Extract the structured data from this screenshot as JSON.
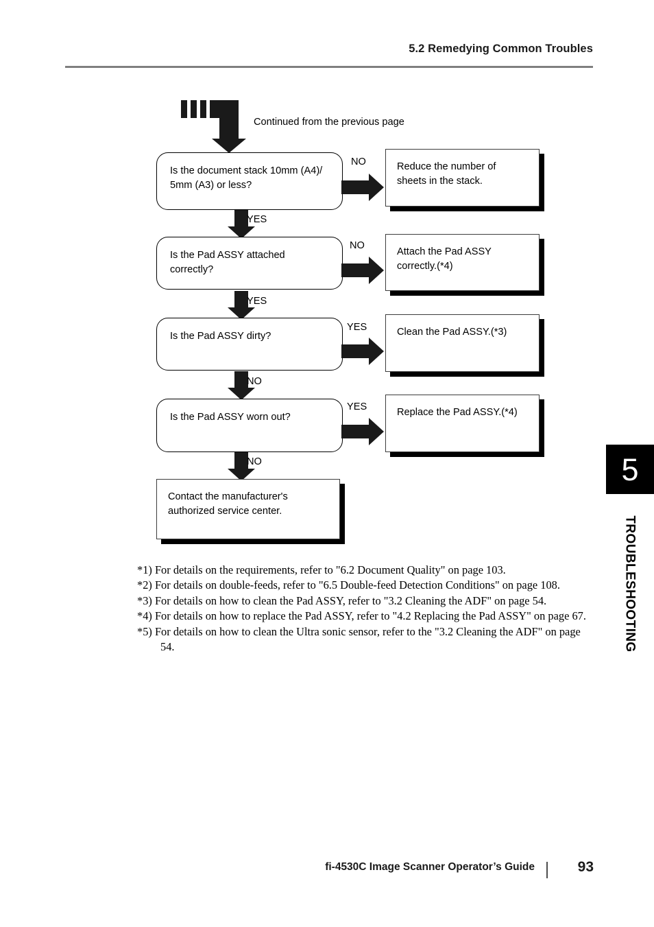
{
  "header": {
    "title": "5.2 Remedying Common Troubles"
  },
  "flowchart": {
    "continued_label": "Continued from the previous page",
    "entry_arrow_icon": "continued-arrow-icon",
    "steps": [
      {
        "question": "Is the document stack 10mm (A4)/\n5mm (A3) or less?",
        "branch_side_label": "NO",
        "branch_down_label": "YES",
        "action": "Reduce the number of\nsheets in the stack."
      },
      {
        "question": "Is the Pad ASSY attached\ncorrectly?",
        "branch_side_label": "NO",
        "branch_down_label": "YES",
        "action": "Attach the Pad ASSY\ncorrectly.(*4)"
      },
      {
        "question": "Is the Pad ASSY dirty?",
        "branch_side_label": "YES",
        "branch_down_label": "NO",
        "action": "Clean the Pad ASSY.(*3)"
      },
      {
        "question": "Is the Pad ASSY worn out?",
        "branch_side_label": "YES",
        "branch_down_label": "NO",
        "action": "Replace the Pad ASSY.(*4)"
      }
    ],
    "final_action": "Contact the manufacturer's\nauthorized service center."
  },
  "footnotes": [
    "*1) For details on the requirements, refer to \"6.2 Document Quality\" on page 103.",
    "*2) For details on double-feeds, refer to \"6.5 Double-feed Detection Conditions\" on page 108.",
    "*3) For details on how to clean the Pad ASSY, refer to \"3.2 Cleaning the ADF\" on page 54.",
    "*4) For details on how to replace the Pad ASSY, refer to \"4.2 Replacing the Pad ASSY\" on page 67.",
    "*5) For details on how to clean the Ultra sonic sensor, refer to the \"3.2 Cleaning the ADF\" on page 54."
  ],
  "chapter_tab": {
    "number": "5",
    "label": "TROUBLESHOOTING"
  },
  "footer": {
    "guide": "fi-4530C Image Scanner Operator’s Guide",
    "page": "93"
  },
  "colors": {
    "rule": "#7f7f7f",
    "tab_background": "#000000",
    "tab_number": "#ffffff",
    "text": "#000000"
  }
}
